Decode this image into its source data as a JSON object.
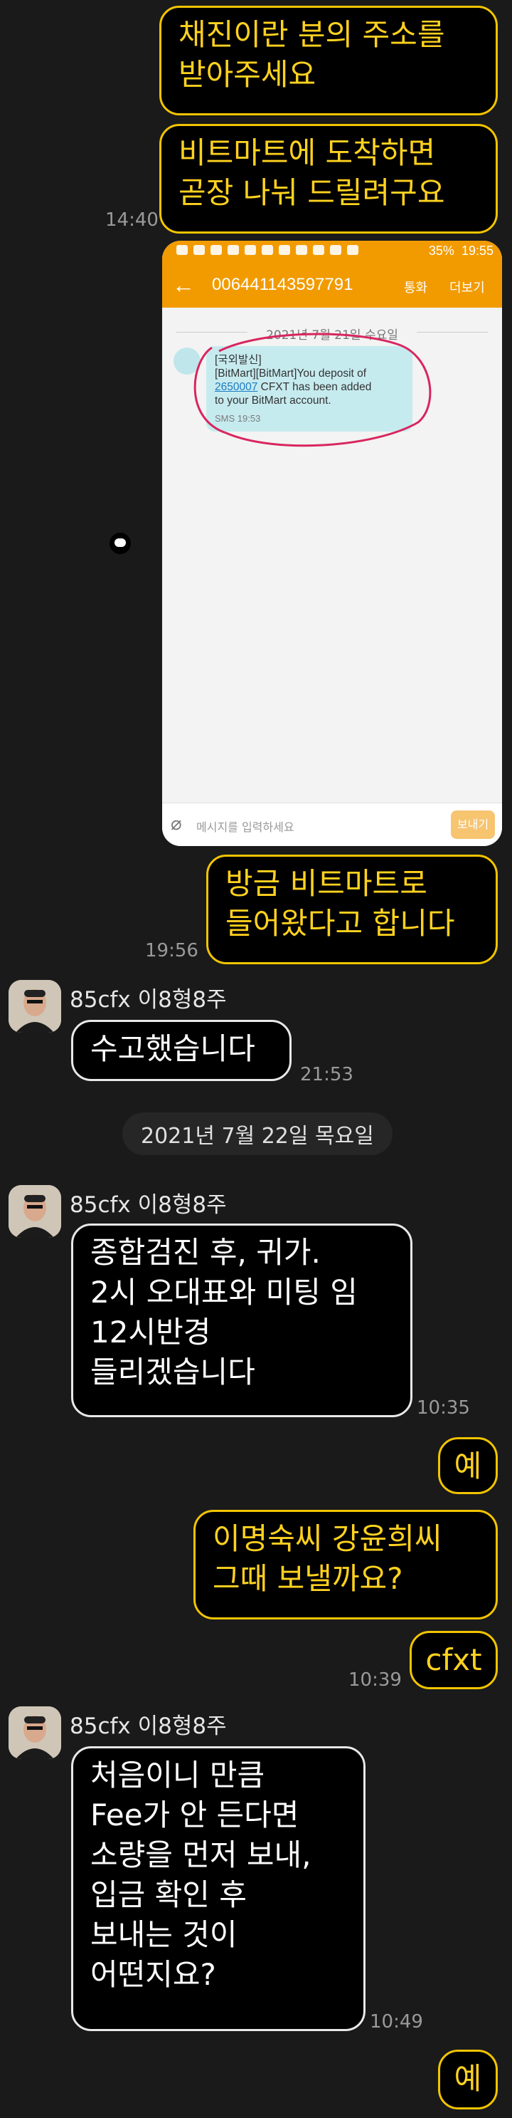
{
  "messages_top": [
    {
      "text": "채진이란 분의 주소를\n받아주세요"
    },
    {
      "text": "비트마트에 도착하면\n곧장 나눠 드릴려구요",
      "time": "14:40"
    }
  ],
  "embedded_screenshot": {
    "status_time": "19:55",
    "status_battery": "35%",
    "phone_number": "006441143597791",
    "action_call": "통화",
    "action_more": "더보기",
    "date_divider": "2021년 7월 21일 수요일",
    "sms_line1": "[국외발신]",
    "sms_line2": "[BitMart][BitMart]You deposit of",
    "sms_amount": "2650007",
    "sms_line3": " CFXT has been added",
    "sms_line4": "to your BitMart account.",
    "sms_meta": "SMS 19:53",
    "input_placeholder": "메시지를 입력하세요",
    "send_label": "보내기",
    "back_icon": "arrow-left-icon",
    "clip_icon": "paperclip-icon"
  },
  "msg_after_screenshot": {
    "text": "방금 비트마트로\n들어왔다고 합니다",
    "time": "19:56"
  },
  "block1": {
    "sender": "85cfx 이8형8주",
    "text": "수고했습니다",
    "time": "21:53"
  },
  "date_divider": "2021년 7월 22일 목요일",
  "block2": {
    "sender": "85cfx 이8형8주",
    "text": "종합검진 후, 귀가.\n2시 오대표와 미팅 임\n12시반경\n들리겠습니다",
    "time": "10:35"
  },
  "me_ye1": {
    "text": "예"
  },
  "me_names": {
    "text": "이명숙씨 강윤희씨\n그때 보낼까요?"
  },
  "me_cfxt": {
    "text": "cfxt",
    "time": "10:39"
  },
  "block3": {
    "sender": "85cfx 이8형8주",
    "text": "처음이니 만큼\nFee가 안 든다면\n소량을 먼저 보내,\n입금 확인 후\n보내는 것이\n어떤지요?",
    "time": "10:49"
  },
  "me_ye2": {
    "text": "예"
  },
  "colors": {
    "background": "#1a1a1a",
    "my_bubble_border": "#f2c400",
    "my_text": "#ffd21f",
    "phone_header": "#f29b00"
  }
}
